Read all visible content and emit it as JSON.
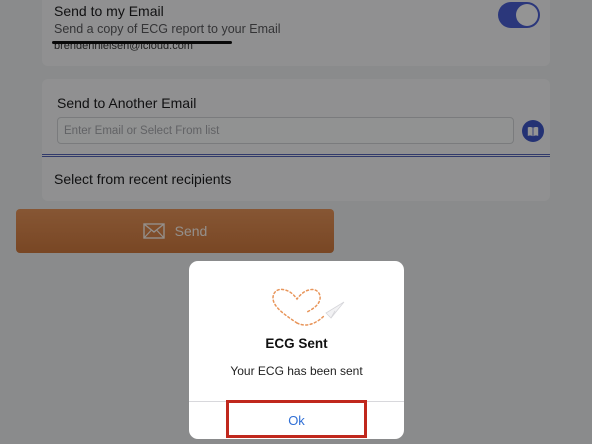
{
  "my_email": {
    "title": "Send to my Email",
    "subtitle": "Send a copy of ECG report to your Email",
    "address": "brendennielsen@icloud.com",
    "toggle_on": true
  },
  "another_email": {
    "title": "Send to Another Email",
    "input_placeholder": "Enter Email or Select From list",
    "input_value": "",
    "list_icon": "address-book-icon",
    "recent_label": "Select from recent recipients"
  },
  "send_button": {
    "label": "Send",
    "icon": "envelope-icon"
  },
  "dialog": {
    "art": "heart-paper-plane-icon",
    "title": "ECG Sent",
    "message": "Your ECG has been sent",
    "ok_label": "Ok"
  },
  "colors": {
    "accent_blue": "#3f56c8",
    "send_orange": "#d88447",
    "highlight_red": "#c0281d",
    "link_blue": "#2f6fd6"
  }
}
